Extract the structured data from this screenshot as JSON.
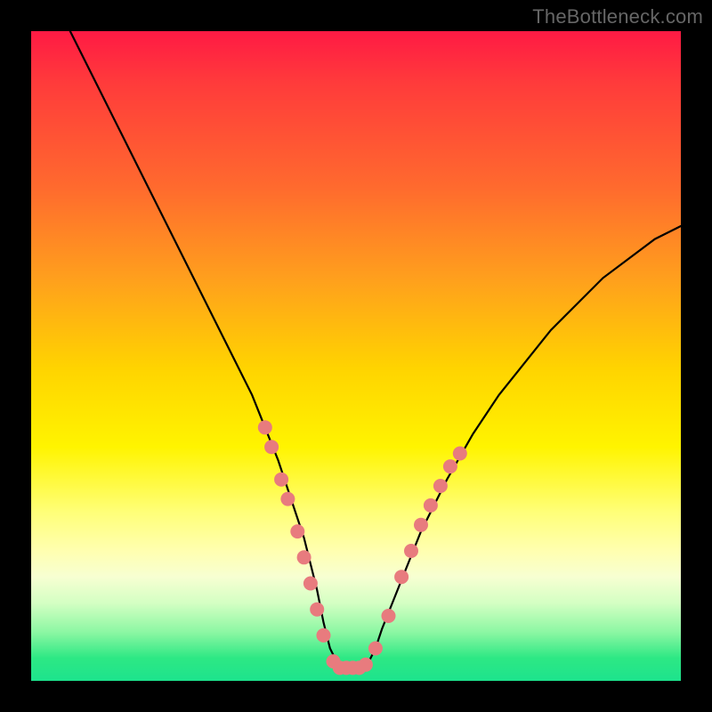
{
  "watermark": "TheBottleneck.com",
  "colors": {
    "frame": "#000000",
    "marker": "#e87b7e",
    "curve": "#000000"
  },
  "chart_data": {
    "type": "line",
    "title": "",
    "xlabel": "",
    "ylabel": "",
    "xlim": [
      0,
      100
    ],
    "ylim": [
      0,
      100
    ],
    "grid": false,
    "legend": false,
    "series": [
      {
        "name": "bottleneck-curve",
        "x": [
          6,
          10,
          14,
          18,
          22,
          26,
          30,
          34,
          36,
          38,
          40,
          42,
          43,
          44,
          45,
          46,
          47,
          48,
          49,
          50,
          51,
          52,
          53,
          54,
          56,
          58,
          60,
          64,
          68,
          72,
          76,
          80,
          84,
          88,
          92,
          96,
          100
        ],
        "y": [
          100,
          92,
          84,
          76,
          68,
          60,
          52,
          44,
          39,
          34,
          28,
          22,
          18,
          14,
          9,
          5,
          3,
          2,
          2,
          2,
          2,
          3,
          5,
          8,
          13,
          18,
          23,
          31,
          38,
          44,
          49,
          54,
          58,
          62,
          65,
          68,
          70
        ]
      }
    ],
    "markers": {
      "name": "highlight-points",
      "points": [
        {
          "x": 36,
          "y": 39
        },
        {
          "x": 37,
          "y": 36
        },
        {
          "x": 38.5,
          "y": 31
        },
        {
          "x": 39.5,
          "y": 28
        },
        {
          "x": 41,
          "y": 23
        },
        {
          "x": 42,
          "y": 19
        },
        {
          "x": 43,
          "y": 15
        },
        {
          "x": 44,
          "y": 11
        },
        {
          "x": 45,
          "y": 7
        },
        {
          "x": 46.5,
          "y": 3
        },
        {
          "x": 47.5,
          "y": 2
        },
        {
          "x": 48.5,
          "y": 2
        },
        {
          "x": 49.5,
          "y": 2
        },
        {
          "x": 50.5,
          "y": 2
        },
        {
          "x": 51.5,
          "y": 2.5
        },
        {
          "x": 53,
          "y": 5
        },
        {
          "x": 55,
          "y": 10
        },
        {
          "x": 57,
          "y": 16
        },
        {
          "x": 58.5,
          "y": 20
        },
        {
          "x": 60,
          "y": 24
        },
        {
          "x": 61.5,
          "y": 27
        },
        {
          "x": 63,
          "y": 30
        },
        {
          "x": 64.5,
          "y": 33
        },
        {
          "x": 66,
          "y": 35
        }
      ],
      "radius_pct": 1.1
    }
  }
}
